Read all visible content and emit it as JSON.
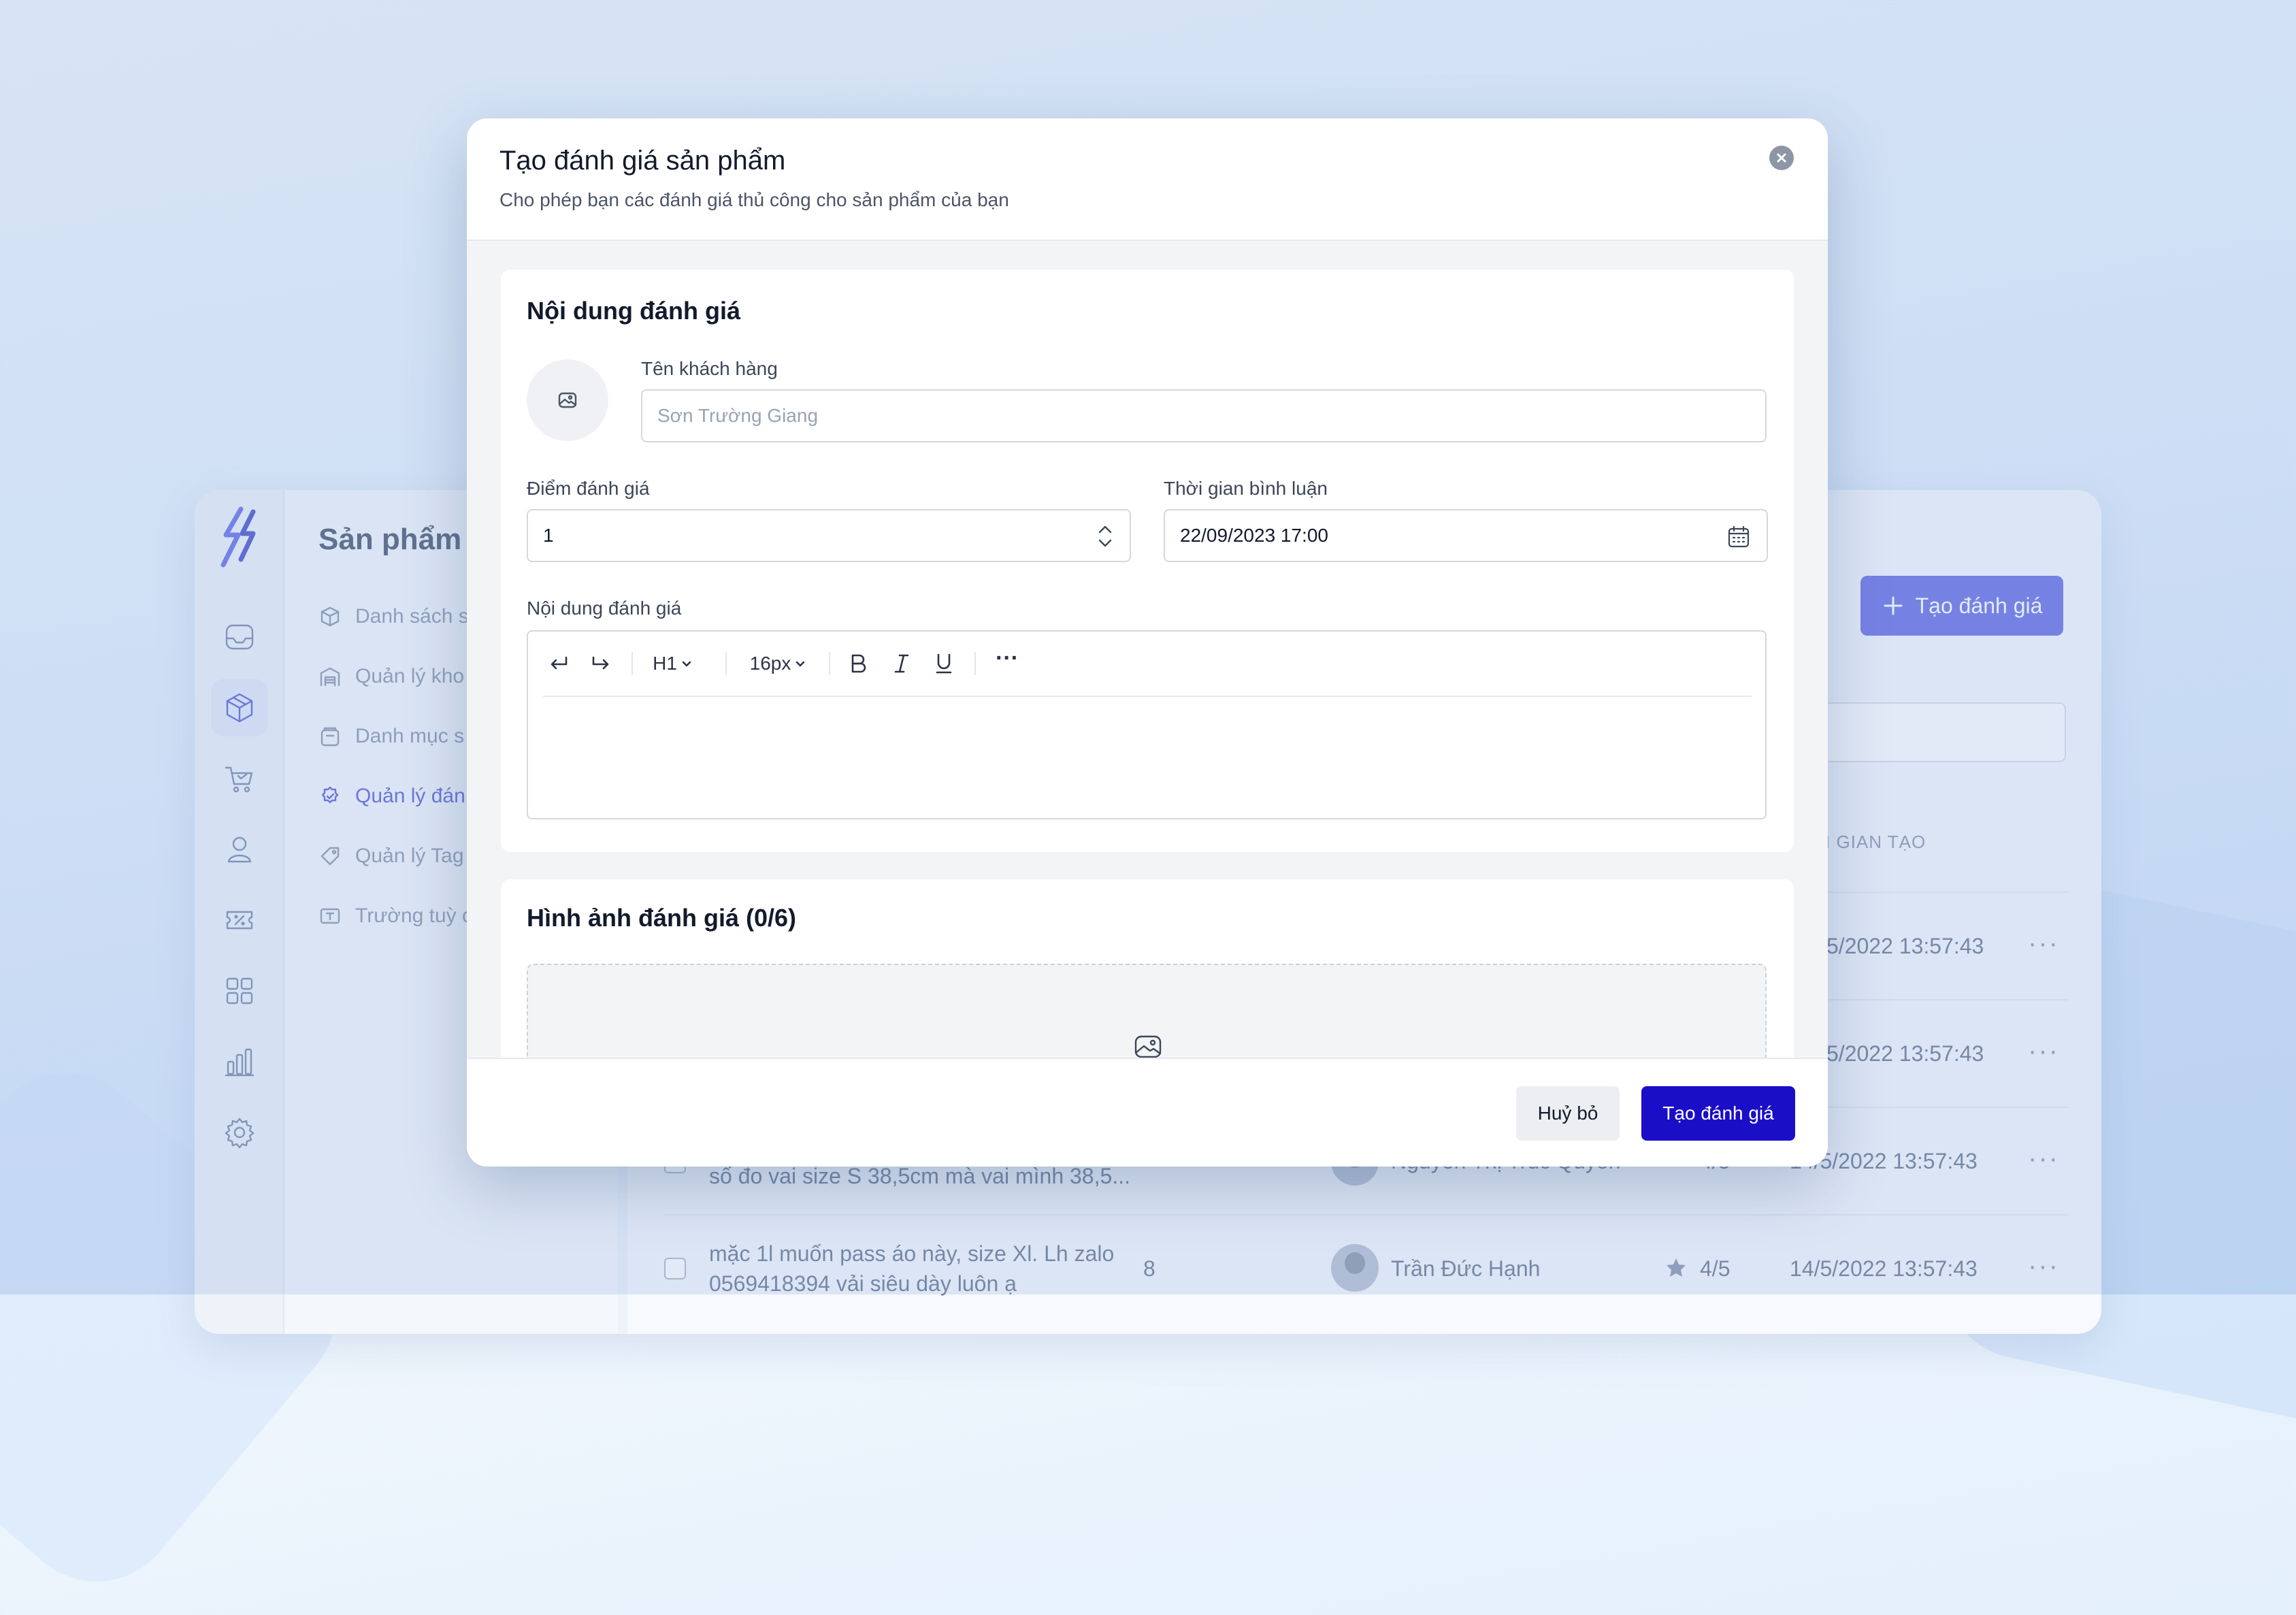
{
  "colors": {
    "primary": "#1a0ec7",
    "accent_background_button": "#6a6fe4",
    "active_nav": "#5a60d6"
  },
  "background_app": {
    "section_title": "Sản phẩm",
    "sidebar_icons": [
      "inbox-icon",
      "box-icon",
      "cart-icon",
      "user-icon",
      "voucher-icon",
      "grid-icon",
      "bar-chart-icon",
      "gear-icon"
    ],
    "subnav": [
      {
        "label": "Danh sách s",
        "icon": "box-icon",
        "active": false
      },
      {
        "label": "Quản lý kho",
        "icon": "warehouse-icon",
        "active": false
      },
      {
        "label": "Danh mục s",
        "icon": "folder-icon",
        "active": false
      },
      {
        "label": "Quản lý đán",
        "icon": "badge-icon",
        "active": true
      },
      {
        "label": "Quản lý Tag",
        "icon": "tag-icon",
        "active": false
      },
      {
        "label": "Trường tuỳ c",
        "icon": "text-field-icon",
        "active": false
      }
    ],
    "create_button_label": "Tạo đánh giá",
    "column_header_partial": "I GIAN TẠO",
    "rows": [
      {
        "time": "5/2022 13:57:43"
      },
      {
        "time": "5/2022 13:57:43"
      },
      {
        "content_line2": "số đo vai size S 38,5cm mà vai mình 38,5...",
        "author_partial": "Nguyễn Thị Trúc Quyên",
        "rating_partial": "4/5",
        "time": "14/5/2022 13:57:43"
      },
      {
        "content_line1": "mặc 1l muốn pass áo này, size Xl. Lh zalo",
        "content_line2": "0569418394 vải siêu dày luôn ạ",
        "count": "8",
        "author": "Trần Đức Hạnh",
        "rating": "4/5",
        "time": "14/5/2022 13:57:43"
      }
    ]
  },
  "modal": {
    "title": "Tạo đánh giá sản phẩm",
    "subtitle": "Cho phép bạn các đánh giá thủ công cho sản phẩm của bạn",
    "content_section": {
      "title": "Nội dung đánh giá",
      "customer_name_label": "Tên khách hàng",
      "customer_name_placeholder": "Sơn Trường Giang",
      "rating_label": "Điểm đánh giá",
      "rating_value": "1",
      "comment_time_label": "Thời gian bình luận",
      "comment_time_value": "22/09/2023 17:00",
      "content_label": "Nội dung đánh giá",
      "toolbar": {
        "heading": "H1",
        "font_size": "16px",
        "more": "···"
      }
    },
    "images_section": {
      "title": "Hình ảnh đánh giá (0/6)"
    },
    "footer": {
      "cancel_label": "Huỷ bỏ",
      "submit_label": "Tạo đánh giá"
    }
  }
}
